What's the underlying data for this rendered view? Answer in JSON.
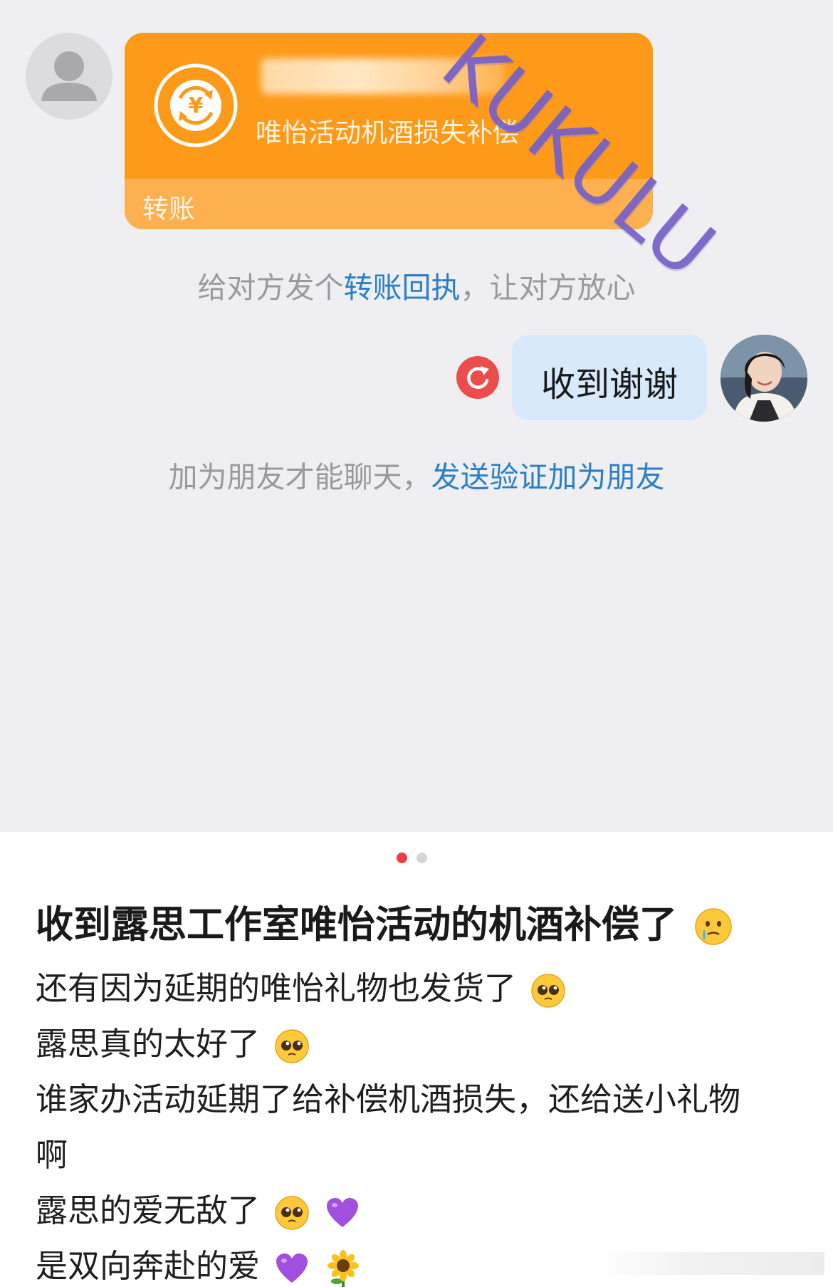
{
  "chat": {
    "transfer_card": {
      "note": "唯怡活动机酒损失补偿",
      "label": "转账",
      "icon": "yuan-exchange-icon",
      "color": "#fe9a1a"
    },
    "watermark": "KUKULU",
    "receipt_prompt": {
      "prefix": "给对方发个",
      "link": "转账回执",
      "suffix": "，让对方放心"
    },
    "my_message": "收到谢谢",
    "resend_icon": "resend-icon",
    "friend_prompt": {
      "prefix": "加为朋友才能聊天，",
      "link": "发送验证加为朋友"
    }
  },
  "post": {
    "page_indicator": {
      "total": 2,
      "active": 1
    },
    "title": "收到露思工作室唯怡活动的机酒补偿了",
    "title_emoji": "crying-face-emoji",
    "lines": [
      {
        "text": "还有因为延期的唯怡礼物也发货了",
        "emojis": [
          "pleading-face-emoji"
        ]
      },
      {
        "text": "露思真的太好了",
        "emojis": [
          "pleading-face-emoji"
        ]
      },
      {
        "text": "谁家办活动延期了给补偿机酒损失，还给送小礼物",
        "emojis": []
      },
      {
        "text": "啊",
        "emojis": []
      },
      {
        "text": "露思的爱无敌了",
        "emojis": [
          "pleading-face-emoji",
          "purple-heart-emoji"
        ]
      },
      {
        "text": "是双向奔赴的爱",
        "emojis": [
          "purple-heart-emoji",
          "sunflower-emoji"
        ]
      }
    ]
  }
}
